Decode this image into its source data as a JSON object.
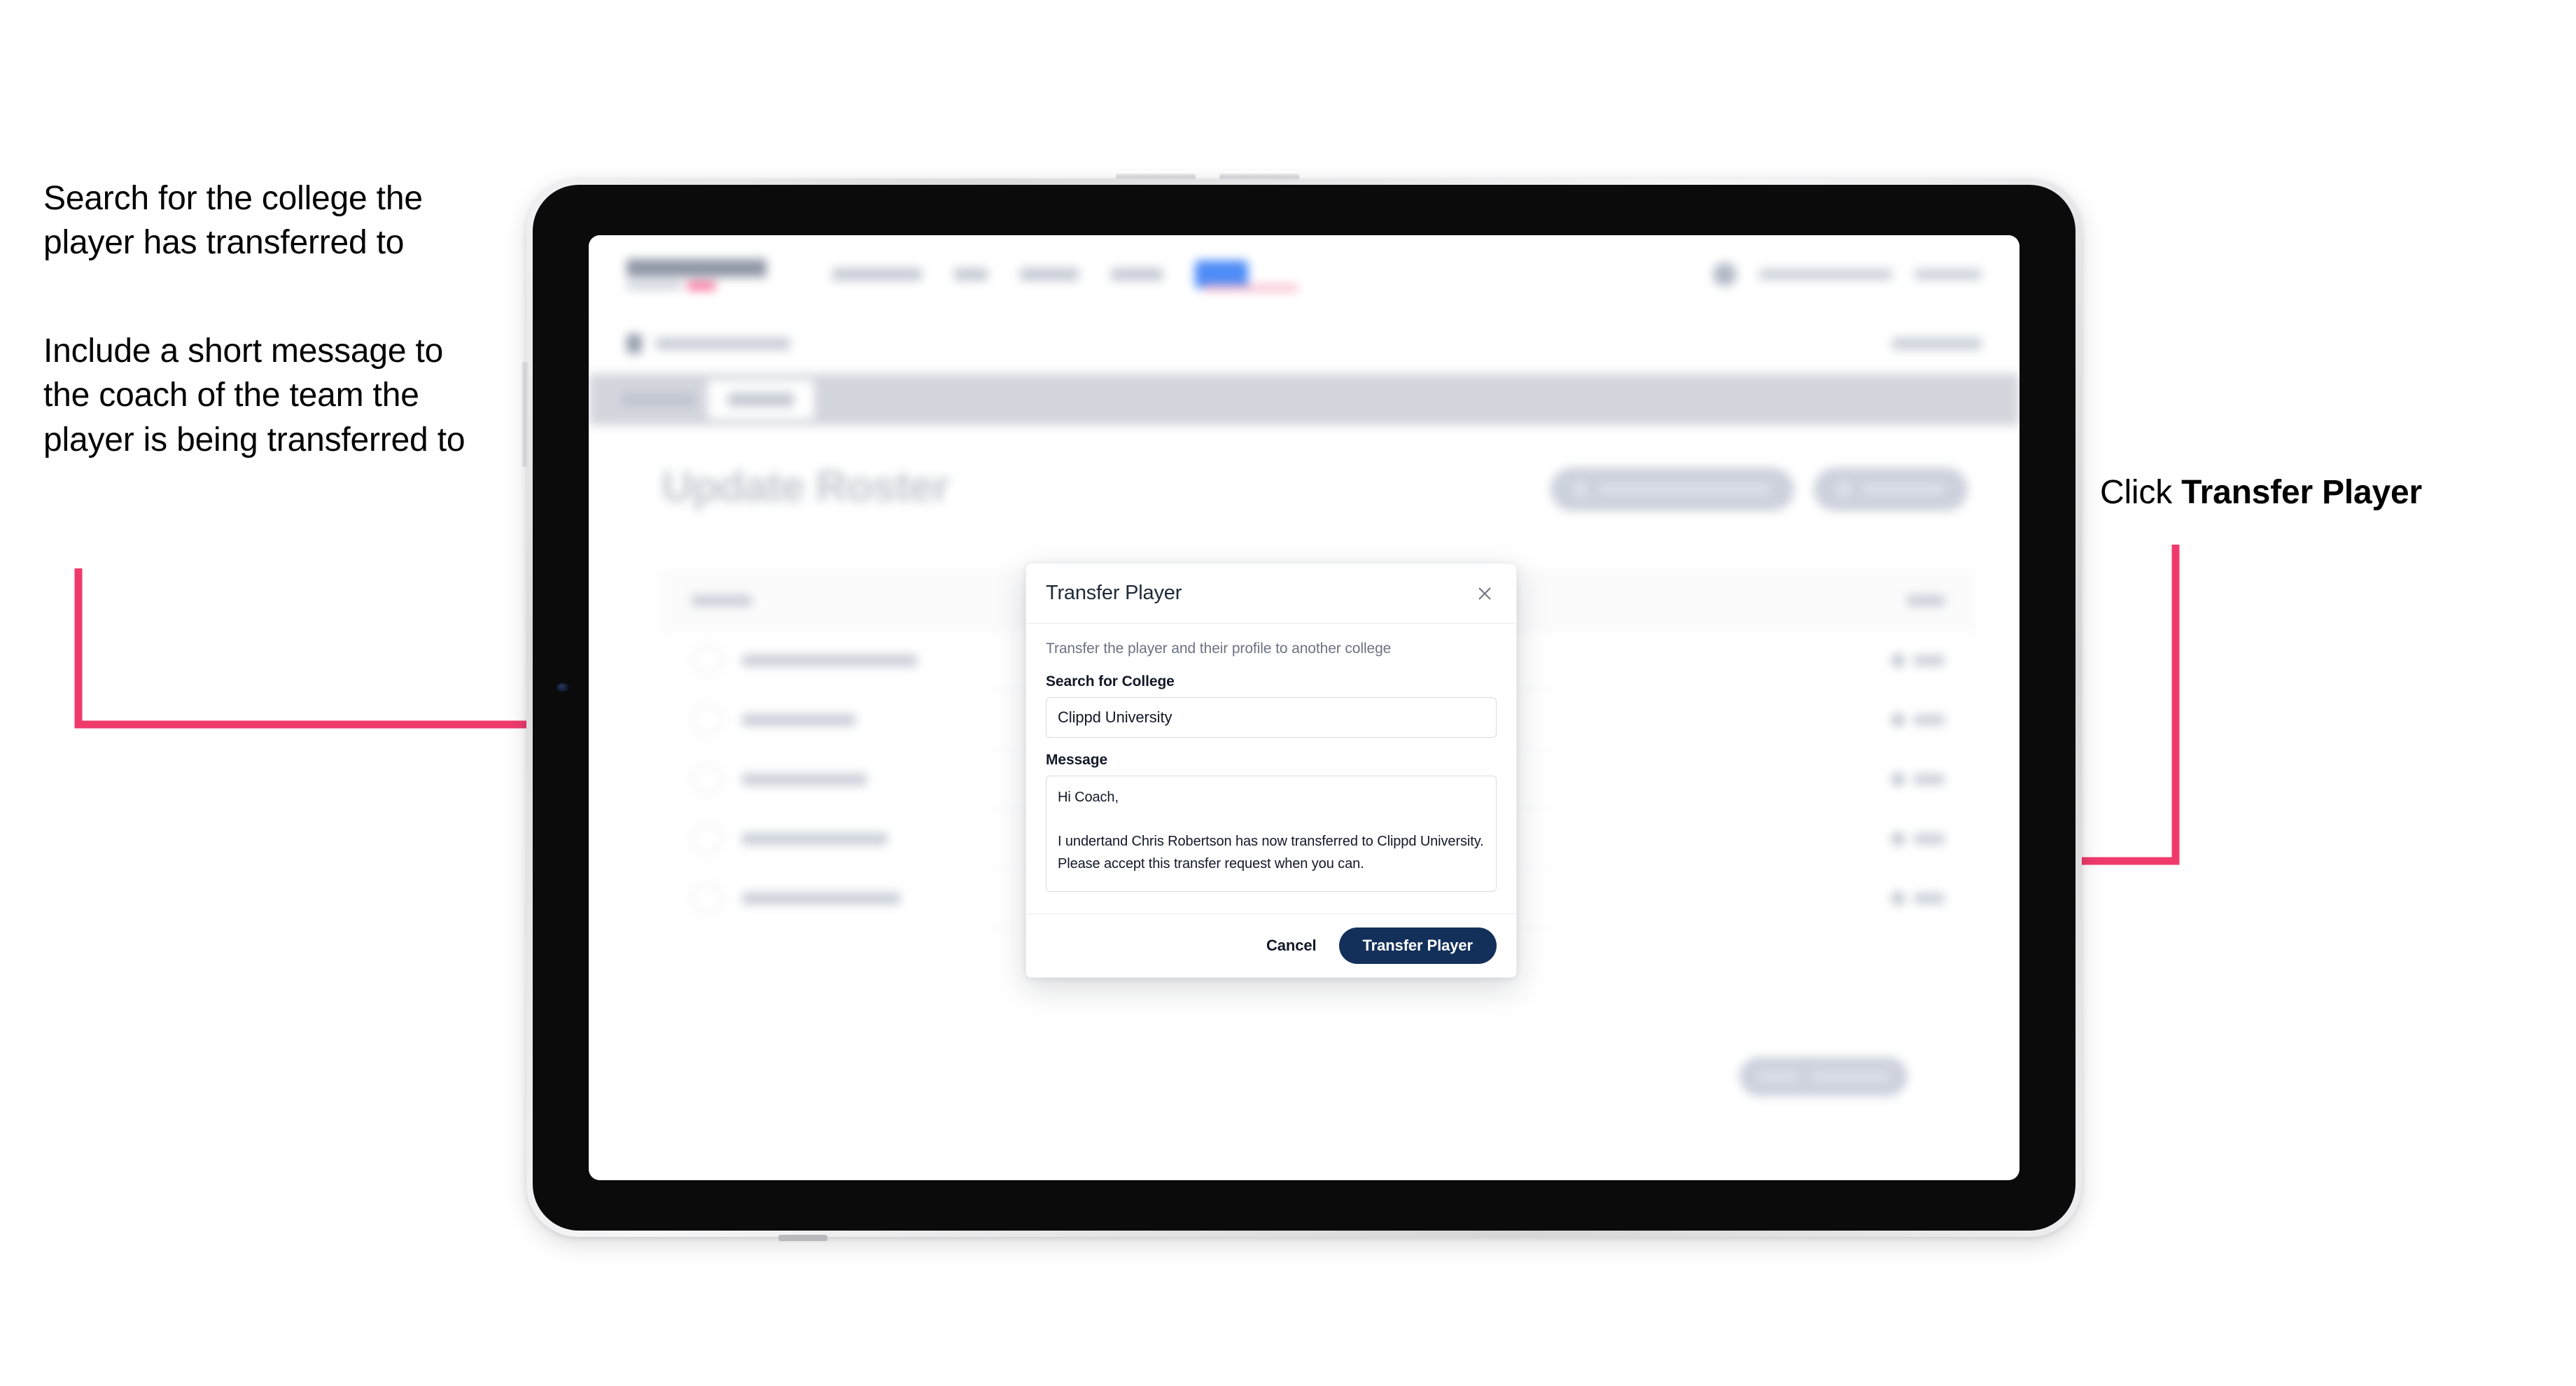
{
  "annotations": {
    "left_note_1": "Search for the college the player has transferred to",
    "left_note_2": "Include a short message to the coach of the team the player is being transferred to",
    "right_note_prefix": "Click ",
    "right_note_emphasis": "Transfer Player",
    "arrow_color": "#ef3b6c"
  },
  "device": {
    "type": "tablet",
    "frame_color": "#dcdcde",
    "bezel_color": "#0b0b0c",
    "screen_color": "#ffffff"
  },
  "app": {
    "page_heading": "Update Roster",
    "accent_nav_pill_color": "#4e8cf7",
    "brand_accent_color": "#f6638f",
    "tabbar_color": "#d3d6dd",
    "roster_row_count": 5
  },
  "modal": {
    "title": "Transfer Player",
    "close_icon": "close-icon",
    "subtitle": "Transfer the player and their profile to another college",
    "college_field": {
      "label": "Search for College",
      "value": "Clippd University",
      "placeholder": "Search for College"
    },
    "message_field": {
      "label": "Message",
      "value": "Hi Coach,\n\nI undertand Chris Robertson has now transferred to Clippd University. Please accept this transfer request when you can.",
      "placeholder": "Message"
    },
    "cancel_label": "Cancel",
    "submit_label": "Transfer Player",
    "submit_color": "#12305a"
  }
}
